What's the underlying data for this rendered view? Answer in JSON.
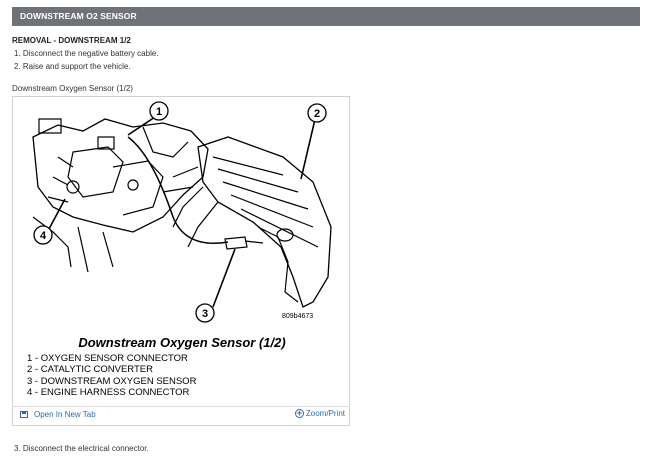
{
  "header": {
    "title": "DOWNSTREAM O2 SENSOR"
  },
  "section": {
    "title": "REMOVAL - DOWNSTREAM 1/2",
    "steps": [
      "1. Disconnect the negative battery cable.",
      "2. Raise and support the vehicle."
    ]
  },
  "figure": {
    "caption": "Downstream Oxygen Sensor (1/2)",
    "title": "Downstream Oxygen Sensor (1/2)",
    "ref": "809b4673",
    "callouts": [
      "1",
      "2",
      "3",
      "4"
    ],
    "legend": [
      "1 - OXYGEN SENSOR CONNECTOR",
      "2 - CATALYTIC CONVERTER",
      "3 - DOWNSTREAM OXYGEN SENSOR",
      "4 - ENGINE HARNESS CONNECTOR"
    ],
    "open_tab_label": "Open In New Tab",
    "zoom_label": "Zoom/Print"
  },
  "after_steps": [
    "3. Disconnect the electrical connector."
  ],
  "colors": {
    "header_bg": "#6f7378",
    "link": "#2a6ab0"
  }
}
